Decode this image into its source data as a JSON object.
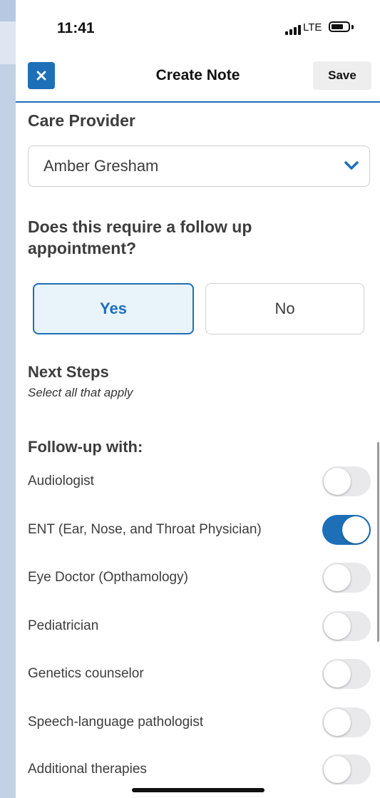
{
  "status_bar": {
    "time": "11:41",
    "network": "LTE"
  },
  "nav": {
    "title": "Create Note",
    "save_label": "Save"
  },
  "care_provider": {
    "label": "Care Provider",
    "selected": "Amber Gresham"
  },
  "follow_up_question": {
    "text": "Does this require a follow up appointment?",
    "yes_label": "Yes",
    "no_label": "No",
    "selected": "Yes"
  },
  "next_steps": {
    "title": "Next Steps",
    "hint": "Select all that apply"
  },
  "follow_up_with": {
    "title": "Follow-up with:",
    "items": [
      {
        "label": "Audiologist",
        "on": false
      },
      {
        "label": "ENT (Ear, Nose, and Throat Physician)",
        "on": true
      },
      {
        "label": "Eye Doctor (Opthamology)",
        "on": false
      },
      {
        "label": "Pediatrician",
        "on": false
      },
      {
        "label": "Genetics counselor",
        "on": false
      },
      {
        "label": "Speech-language pathologist",
        "on": false
      },
      {
        "label": "Additional therapies",
        "on": false
      }
    ]
  },
  "colors": {
    "accent": "#1d6fb8",
    "toggle_off": "#e9e9eb",
    "text": "#3d3d3d"
  }
}
